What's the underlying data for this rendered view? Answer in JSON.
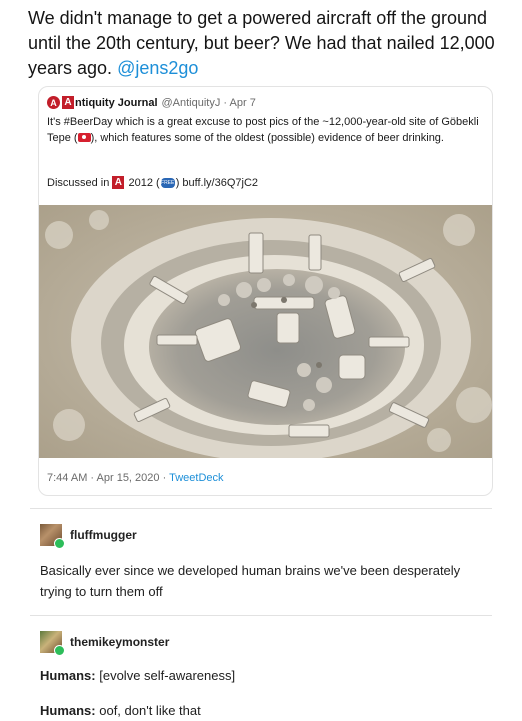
{
  "post": {
    "text": "We didn't manage to get a powered aircraft off the ground until the 20th century, but beer? We had that nailed 12,000 years ago.",
    "mention": "@jens2go"
  },
  "quoted_tweet": {
    "logo_letter": "A",
    "name_initial": "A",
    "account_name": "ntiquity Journal",
    "handle_date": "@AntiquityJ · Apr 7",
    "body_part1": "It's #BeerDay which is a great excuse to post pics of the ~12,000-year-old site of Göbekli Tepe (",
    "body_part2": "), which features some of the oldest (possible) evidence of beer drinking.",
    "discussed_label": "Discussed in",
    "discussed_logo": "A",
    "discussed_year": "2012 (",
    "free_badge": "FREE",
    "discussed_link": ") buff.ly/36Q7jC2",
    "timestamp": "7:44 AM · Apr 15, 2020 · ",
    "via": "TweetDeck",
    "photo_alt": "Aerial view of the Göbekli Tepe excavation site",
    "colors": {
      "logo_red": "#c21e2a",
      "link_blue": "#1d8fd8"
    }
  },
  "comments": [
    {
      "username": "fluffmugger",
      "text": "Basically ever since we developed human brains we've been desperately trying to turn them off"
    },
    {
      "username": "themikeymonster",
      "lines": [
        {
          "speaker": "Humans:",
          "text": " [evolve self-awareness]"
        },
        {
          "speaker": "Humans:",
          "text": " oof, don't like that"
        }
      ]
    }
  ]
}
